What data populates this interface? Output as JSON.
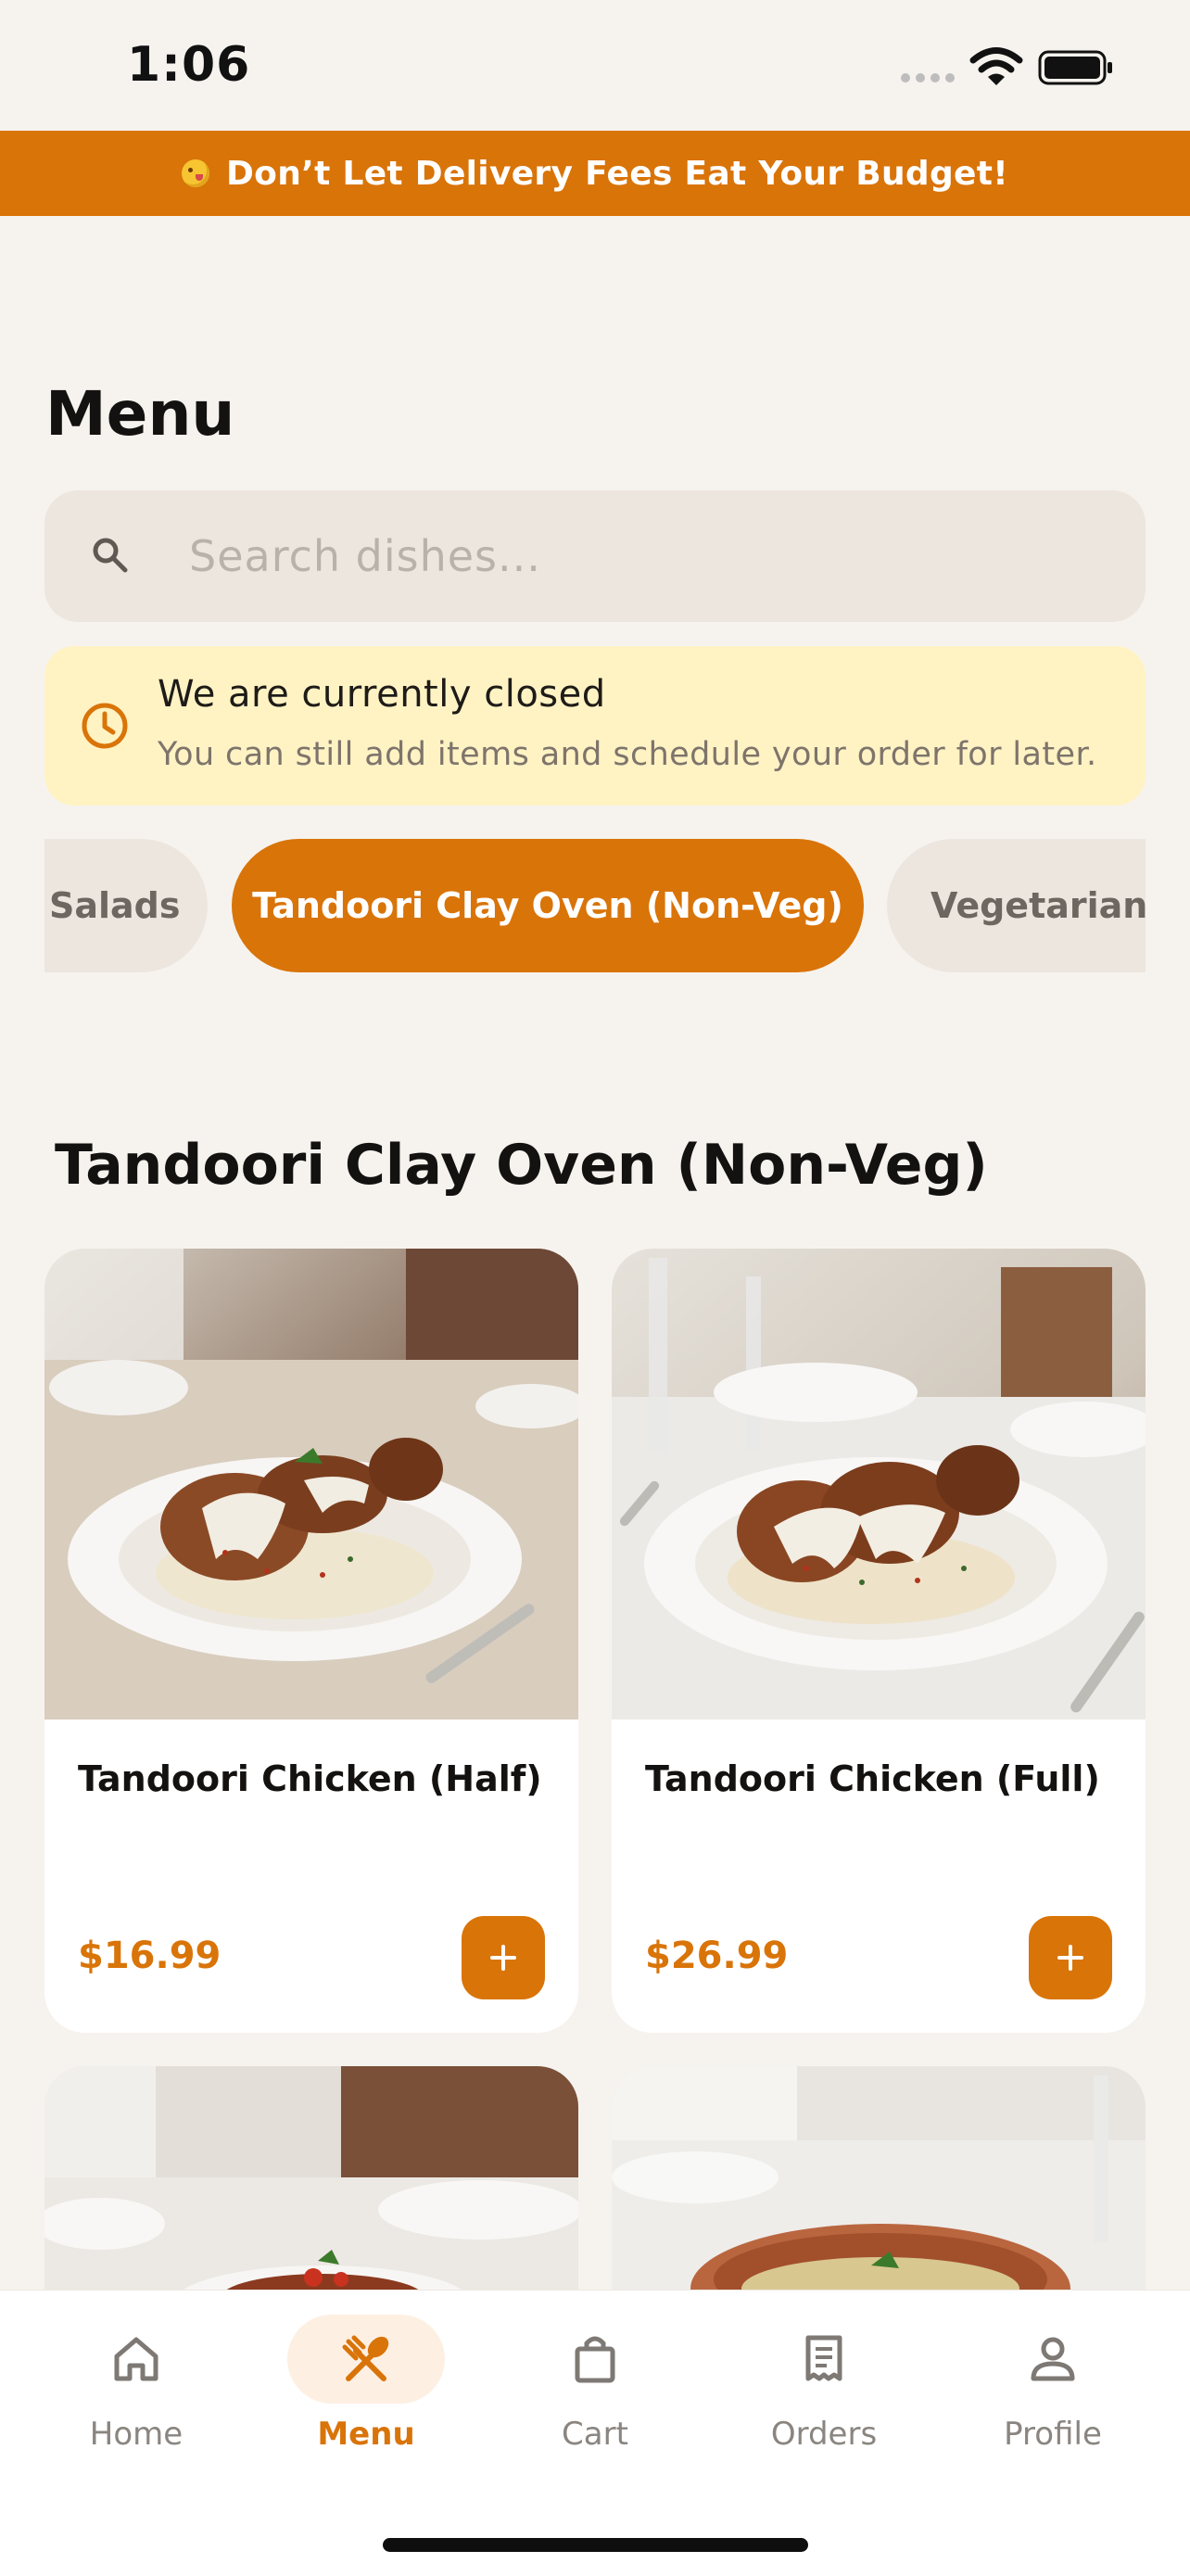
{
  "status_bar": {
    "time": "1:06"
  },
  "promo_banner": {
    "text": "Don’t Let Delivery Fees Eat Your Budget!",
    "emoji": "smiling-face-tongue-emoji"
  },
  "page": {
    "title": "Menu"
  },
  "search": {
    "placeholder": "Search dishes...",
    "value": ""
  },
  "notice": {
    "title": "We are currently closed",
    "subtitle": "You can still add items and schedule your order for later.",
    "icon": "clock-icon"
  },
  "categories": {
    "items": [
      {
        "label": "Salads",
        "active": false
      },
      {
        "label": "Tandoori Clay Oven (Non-Veg)",
        "active": true
      },
      {
        "label": "Vegetarian Curries",
        "active": false
      }
    ]
  },
  "section": {
    "title": "Tandoori Clay Oven (Non-Veg)"
  },
  "products": [
    {
      "name": "Tandoori Chicken (Half)",
      "price": "$16.99",
      "add_label": "+"
    },
    {
      "name": "Tandoori Chicken (Full)",
      "price": "$26.99",
      "add_label": "+"
    }
  ],
  "bottom_nav": {
    "items": [
      {
        "label": "Home",
        "icon": "home-icon",
        "active": false
      },
      {
        "label": "Menu",
        "icon": "fork-spoon-icon",
        "active": true
      },
      {
        "label": "Cart",
        "icon": "shopping-bag-icon",
        "active": false
      },
      {
        "label": "Orders",
        "icon": "receipt-icon",
        "active": false
      },
      {
        "label": "Profile",
        "icon": "person-icon",
        "active": false
      }
    ]
  },
  "colors": {
    "accent": "#D97409",
    "background": "#F6F3EF",
    "notice_bg": "#FFF3C4",
    "chip_inactive": "#EDE6DE"
  }
}
